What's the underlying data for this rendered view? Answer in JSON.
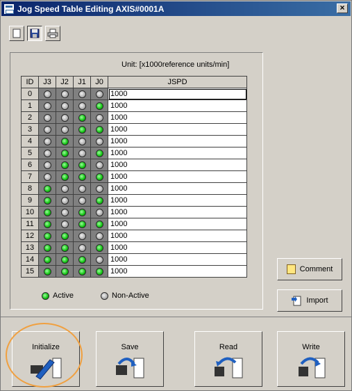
{
  "window": {
    "title": "Jog Speed Table Editing AXIS#0001A",
    "close_label": "×"
  },
  "toolbar": {
    "buttons": [
      {
        "icon": "blank-page-icon",
        "pressed": false
      },
      {
        "icon": "save-disk-icon",
        "pressed": true
      },
      {
        "icon": "printer-icon",
        "pressed": false
      }
    ]
  },
  "table": {
    "unit_label": "Unit:  [x1000reference units/min]",
    "headers": [
      "ID",
      "J3",
      "J2",
      "J1",
      "J0",
      "JSPD"
    ],
    "rows": [
      {
        "id": "0",
        "j3": 0,
        "j2": 0,
        "j1": 0,
        "j0": 0,
        "jspd": "1000"
      },
      {
        "id": "1",
        "j3": 0,
        "j2": 0,
        "j1": 0,
        "j0": 1,
        "jspd": "1000"
      },
      {
        "id": "2",
        "j3": 0,
        "j2": 0,
        "j1": 1,
        "j0": 0,
        "jspd": "1000"
      },
      {
        "id": "3",
        "j3": 0,
        "j2": 0,
        "j1": 1,
        "j0": 1,
        "jspd": "1000"
      },
      {
        "id": "4",
        "j3": 0,
        "j2": 1,
        "j1": 0,
        "j0": 0,
        "jspd": "1000"
      },
      {
        "id": "5",
        "j3": 0,
        "j2": 1,
        "j1": 0,
        "j0": 1,
        "jspd": "1000"
      },
      {
        "id": "6",
        "j3": 0,
        "j2": 1,
        "j1": 1,
        "j0": 0,
        "jspd": "1000"
      },
      {
        "id": "7",
        "j3": 0,
        "j2": 1,
        "j1": 1,
        "j0": 1,
        "jspd": "1000"
      },
      {
        "id": "8",
        "j3": 1,
        "j2": 0,
        "j1": 0,
        "j0": 0,
        "jspd": "1000"
      },
      {
        "id": "9",
        "j3": 1,
        "j2": 0,
        "j1": 0,
        "j0": 1,
        "jspd": "1000"
      },
      {
        "id": "10",
        "j3": 1,
        "j2": 0,
        "j1": 1,
        "j0": 0,
        "jspd": "1000"
      },
      {
        "id": "11",
        "j3": 1,
        "j2": 0,
        "j1": 1,
        "j0": 1,
        "jspd": "1000"
      },
      {
        "id": "12",
        "j3": 1,
        "j2": 1,
        "j1": 0,
        "j0": 0,
        "jspd": "1000"
      },
      {
        "id": "13",
        "j3": 1,
        "j2": 1,
        "j1": 0,
        "j0": 1,
        "jspd": "1000"
      },
      {
        "id": "14",
        "j3": 1,
        "j2": 1,
        "j1": 1,
        "j0": 0,
        "jspd": "1000"
      },
      {
        "id": "15",
        "j3": 1,
        "j2": 1,
        "j1": 1,
        "j0": 1,
        "jspd": "1000"
      }
    ],
    "selected_row": "0"
  },
  "legend": {
    "active_label": "Active",
    "inactive_label": "Non-Active"
  },
  "side_buttons": {
    "comment_label": "Comment",
    "import_label": "Import"
  },
  "bottom_buttons": {
    "initialize_label": "Initialize",
    "save_label": "Save",
    "read_label": "Read",
    "write_label": "Write"
  },
  "colors": {
    "active_led": "#10c010",
    "inactive_led": "#b0b0b0",
    "highlight_ring": "#f0a040",
    "titlebar": "#0a246a"
  }
}
